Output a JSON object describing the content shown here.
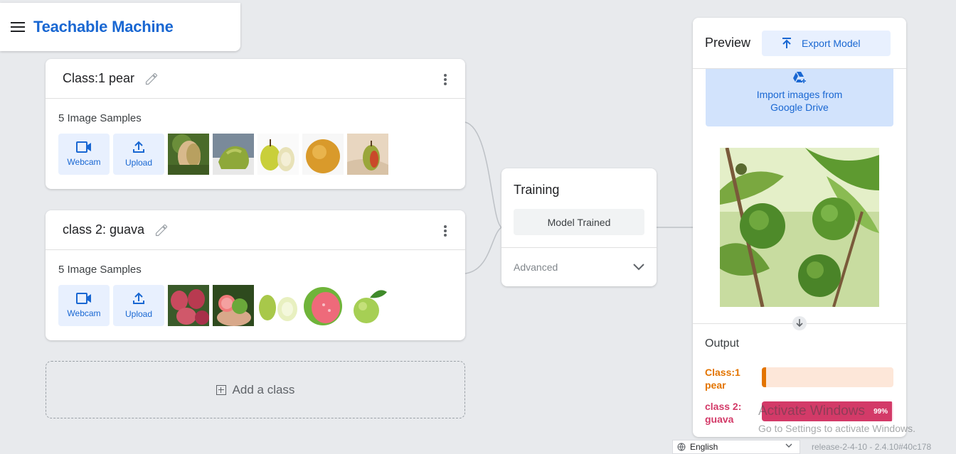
{
  "app": {
    "title": "Teachable Machine"
  },
  "classes": [
    {
      "name": "Class:1 pear",
      "samples_label": "5 Image Samples",
      "webcam_label": "Webcam",
      "upload_label": "Upload"
    },
    {
      "name": "class 2: guava",
      "samples_label": "5 Image Samples",
      "webcam_label": "Webcam",
      "upload_label": "Upload"
    }
  ],
  "add_class": {
    "label": "Add a class"
  },
  "training": {
    "title": "Training",
    "status_button": "Model Trained",
    "advanced_label": "Advanced"
  },
  "preview": {
    "title": "Preview",
    "export_label": "Export Model",
    "import_drive_label": "Import images from Google Drive",
    "output_title": "Output",
    "outputs": [
      {
        "label": "Class:1 pear",
        "percent": 1,
        "percent_text": "",
        "color": "#e37400",
        "track_color": "#fde7d9"
      },
      {
        "label": "class 2: guava",
        "percent": 99,
        "percent_text": "99%",
        "color": "#d33a68",
        "track_color": "#fce4ec"
      }
    ]
  },
  "watermark": {
    "title": "Activate Windows",
    "subtitle": "Go to Settings to activate Windows."
  },
  "footer": {
    "language": "English",
    "release": "release-2-4-10 - 2.4.10#40c178"
  },
  "colors": {
    "accent": "#1967d2",
    "accent_light": "#e8f0fe",
    "background": "#e8eaed"
  },
  "icons": [
    "menu-icon",
    "pencil-icon",
    "more-vert-icon",
    "webcam-icon",
    "upload-icon",
    "add-box-icon",
    "chevron-down-icon",
    "export-icon",
    "google-drive-icon",
    "arrow-down-icon",
    "globe-icon"
  ]
}
